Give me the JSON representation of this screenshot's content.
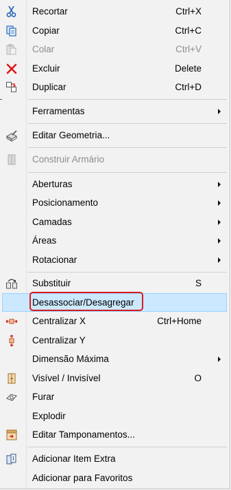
{
  "menu": {
    "items": [
      {
        "label": "Recortar",
        "shortcut": "Ctrl+X",
        "icon": "scissors-icon"
      },
      {
        "label": "Copiar",
        "shortcut": "Ctrl+C",
        "icon": "copy-icon"
      },
      {
        "label": "Colar",
        "shortcut": "Ctrl+V",
        "icon": "paste-icon",
        "disabled": true
      },
      {
        "label": "Excluir",
        "shortcut": "Delete",
        "icon": "delete-x-icon"
      },
      {
        "label": "Duplicar",
        "shortcut": "Ctrl+D",
        "icon": "duplicate-icon"
      },
      {
        "label": "Ferramentas",
        "submenu": true
      },
      {
        "label": "Editar Geometria...",
        "icon": "edit-geometry-icon"
      },
      {
        "label": "Construir Armário",
        "icon": "build-cabinet-icon",
        "disabled": true
      },
      {
        "label": "Aberturas",
        "submenu": true
      },
      {
        "label": "Posicionamento",
        "submenu": true
      },
      {
        "label": "Camadas",
        "submenu": true
      },
      {
        "label": "Áreas",
        "submenu": true
      },
      {
        "label": "Rotacionar",
        "submenu": true
      },
      {
        "label": "Substituir",
        "shortcut": "S",
        "icon": "replace-icon"
      },
      {
        "label": "Desassociar/Desagregar",
        "highlighted": true
      },
      {
        "label": "Centralizar X",
        "shortcut": "Ctrl+Home",
        "icon": "center-x-icon"
      },
      {
        "label": "Centralizar Y",
        "icon": "center-y-icon"
      },
      {
        "label": "Dimensão Máxima",
        "submenu": true
      },
      {
        "label": "Visível / Invisível",
        "shortcut": "O",
        "icon": "visibility-icon"
      },
      {
        "label": "Furar",
        "icon": "drill-icon"
      },
      {
        "label": "Explodir"
      },
      {
        "label": "Editar Tamponamentos...",
        "icon": "edit-covers-icon"
      },
      {
        "label": "Adicionar Item Extra",
        "icon": "add-extra-item-icon"
      },
      {
        "label": "Adicionar para Favoritos"
      }
    ]
  },
  "colors": {
    "highlight_bg": "#cce8ff",
    "highlight_border": "#99d1ff",
    "annotation_box": "#d81b1b",
    "menu_bg": "#f2f2f2"
  }
}
